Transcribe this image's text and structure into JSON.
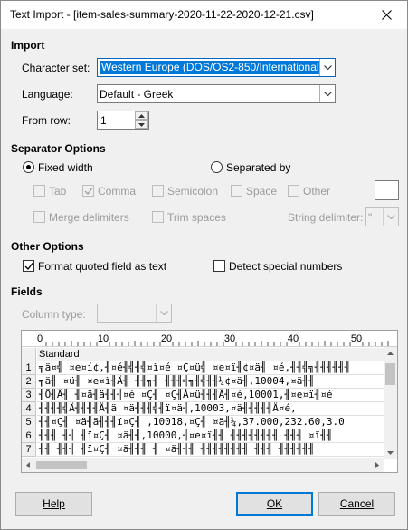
{
  "window": {
    "title": "Text Import - [item-sales-summary-2020-11-22-2020-12-21.csv]"
  },
  "import": {
    "section_title": "Import",
    "charset_label": "Character set:",
    "charset_value": "Western Europe (DOS/OS2-850/International)",
    "language_label": "Language:",
    "language_value": "Default - Greek",
    "from_row_label": "From row:",
    "from_row_value": "1"
  },
  "separator": {
    "section_title": "Separator Options",
    "fixed_width_label": "Fixed width",
    "fixed_width_selected": true,
    "separated_by_label": "Separated by",
    "separated_by_selected": false,
    "tab_label": "Tab",
    "comma_label": "Comma",
    "comma_checked": true,
    "semicolon_label": "Semicolon",
    "space_label": "Space",
    "other_label": "Other",
    "merge_label": "Merge delimiters",
    "trim_label": "Trim spaces",
    "string_delim_label": "String delimiter:",
    "string_delim_value": "\""
  },
  "other_options": {
    "section_title": "Other Options",
    "format_quoted_label": "Format quoted field as text",
    "format_quoted_checked": true,
    "detect_special_label": "Detect special numbers",
    "detect_special_checked": false
  },
  "fields": {
    "section_title": "Fields",
    "column_type_label": "Column type:",
    "column_type_value": "",
    "ruler_ticks": [
      "0",
      "10",
      "20",
      "30",
      "40",
      "50"
    ],
    "column_header": "Standard",
    "rows": [
      {
        "num": "1",
        "text": "╗ä¤╣ ¤е¤í¢,╢¤é╢╣╢╣¤ï¤é ¤Ç¤ü╣ ¤е¤ï╢¢¤ä╢ ¤é,╢╢╣╗╢╢╢╢╢╢"
      },
      {
        "num": "2",
        "text": "╗ä╢ ¤ü╢ ¤е¤ï╢Ä╢ ╢╢╗╢ ╢╢╢╣╗╢╣╢╢¼¢¤ä╢,10004,¤ä╢╢"
      },
      {
        "num": "3",
        "text": "╢Ö╢Ä╢ ╢¤ä╢ä╢╢╢¤é ¤Ç╢ ¤Ç╢Â¤ü╢╢╢Ä╢¤é,10001,╢¤е¤ï╢¤é"
      },
      {
        "num": "4",
        "text": "╢╢╢╢╣Ä╢╢╢╢Ä╢ä ¤ä╢╢╢╣╢ï¤ä╢,10003,¤ä╢╢╢╢╢Ä¤é,"
      },
      {
        "num": "5",
        "text": "╢╢¤Ç╢ ¤ä╢ä╢╢╢ï¤Ç╢ ,10018,¤Ç╢ ¤ä╢¼,37.000,232.60,3.0"
      },
      {
        "num": "6",
        "text": "╢╢╢ ╢╢ ╢ï¤Ç╢ ¤ä╢╢,10000,╢¤е¤ï╢╢ ╢╢╢╢╢╢╢╢ ╢╢╢ ¤ï╢╢"
      },
      {
        "num": "7",
        "text": "╢╢ ╢╢╢ ╢ï¤Ç╢ ¤ä╢╢╢ ╢ ¤ä╢╢╢ ╢╢╢╢╢╢╢╢ ╢╢╢ ╢╢╢╢╢╢"
      }
    ]
  },
  "buttons": {
    "help": "Help",
    "ok": "OK",
    "cancel": "Cancel"
  }
}
